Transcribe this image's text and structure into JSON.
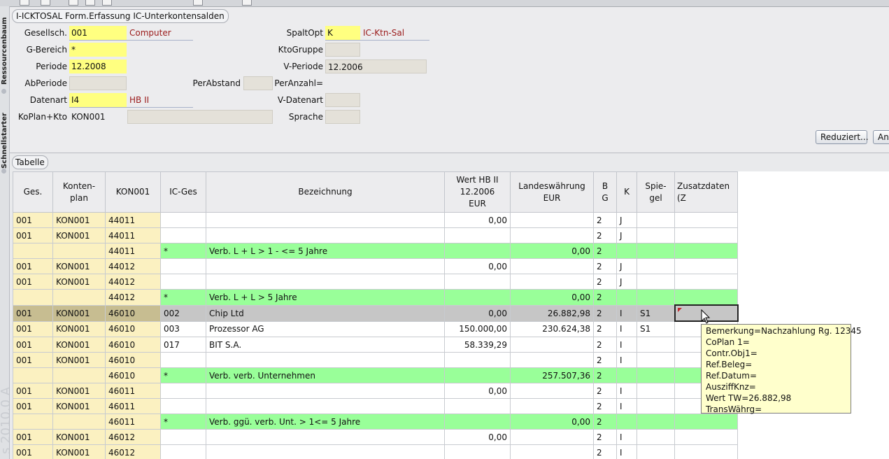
{
  "panel": {
    "title": "I-ICKTOSAL Form.Erfassung IC-Unterkontensalden"
  },
  "sidebar": {
    "tab1": "Ressourcenbaum",
    "tab2": "Schnellstarter",
    "watermark": "s 2010.0 A"
  },
  "form": {
    "gesellsch": {
      "label": "Gesellsch.",
      "value": "001",
      "desc": "Computer"
    },
    "gbereich": {
      "label": "G-Bereich",
      "value": "*"
    },
    "periode": {
      "label": "Periode",
      "value": "12.2008"
    },
    "abperiode": {
      "label": "AbPeriode",
      "value": ""
    },
    "perabstand": {
      "label": "PerAbstand",
      "value": ""
    },
    "datenart": {
      "label": "Datenart",
      "value": "I4",
      "desc": "HB II"
    },
    "koplan": {
      "label": "KoPlan+Kto",
      "value": "KON001",
      "value2": ""
    },
    "spaltopt": {
      "label": "SpaltOpt",
      "value": "K",
      "desc": "IC-Ktn-Sal"
    },
    "ktogruppe": {
      "label": "KtoGruppe",
      "value": ""
    },
    "vperiode": {
      "label": "V-Periode",
      "value": "12.2006"
    },
    "peranzahl": {
      "label": "PerAnzahl="
    },
    "vdatenart": {
      "label": "V-Datenart",
      "value": ""
    },
    "sprache": {
      "label": "Sprache",
      "value": ""
    }
  },
  "buttons": {
    "reduziert": "Reduziert...",
    "an": "An"
  },
  "table": {
    "tab_label": "Tabelle",
    "headers": [
      "Ges.",
      "Konten-\nplan",
      "KON001",
      "IC-Ges",
      "Bezeichnung",
      "Wert HB II\n12.2006\nEUR",
      "Landeswährung\nEUR",
      "B\nG",
      "K",
      "Spie-\ngel",
      "Zusatzdaten (Z"
    ],
    "rows": [
      {
        "type": "normal",
        "cells": [
          "001",
          "KON001",
          "44011",
          "",
          "",
          "0,00",
          "",
          "2",
          "J",
          "",
          ""
        ]
      },
      {
        "type": "normal",
        "cells": [
          "001",
          "KON001",
          "44011",
          "",
          "",
          "",
          "",
          "2",
          "J",
          "",
          ""
        ]
      },
      {
        "type": "green",
        "cells": [
          "",
          "",
          "44011",
          "*",
          "Verb. L + L   > 1 - <= 5 Jahre",
          "",
          "0,00",
          "2",
          "",
          "",
          ""
        ]
      },
      {
        "type": "normal",
        "cells": [
          "001",
          "KON001",
          "44012",
          "",
          "",
          "0,00",
          "",
          "2",
          "J",
          "",
          ""
        ]
      },
      {
        "type": "normal",
        "cells": [
          "001",
          "KON001",
          "44012",
          "",
          "",
          "",
          "",
          "2",
          "J",
          "",
          ""
        ]
      },
      {
        "type": "green",
        "cells": [
          "",
          "",
          "44012",
          "*",
          "Verb. L + L   > 5 Jahre",
          "",
          "0,00",
          "2",
          "",
          "",
          ""
        ]
      },
      {
        "type": "selected",
        "cells": [
          "001",
          "KON001",
          "46010",
          "002",
          "Chip Ltd",
          "0,00",
          "26.882,98",
          "2",
          "I",
          "S1",
          ""
        ]
      },
      {
        "type": "normal",
        "cells": [
          "001",
          "KON001",
          "46010",
          "003",
          "Prozessor AG",
          "150.000,00",
          "230.624,38",
          "2",
          "I",
          "S1",
          ""
        ]
      },
      {
        "type": "normal",
        "cells": [
          "001",
          "KON001",
          "46010",
          "017",
          "BIT S.A.",
          "58.339,29",
          "",
          "2",
          "I",
          "",
          ""
        ]
      },
      {
        "type": "normal",
        "cells": [
          "001",
          "KON001",
          "46010",
          "",
          "",
          "",
          "",
          "2",
          "I",
          "",
          ""
        ]
      },
      {
        "type": "green",
        "cells": [
          "",
          "",
          "46010",
          "*",
          "Verb. verb. Unternehmen",
          "",
          "257.507,36",
          "2",
          "",
          "",
          ""
        ]
      },
      {
        "type": "normal",
        "cells": [
          "001",
          "KON001",
          "46011",
          "",
          "",
          "0,00",
          "",
          "2",
          "I",
          "",
          ""
        ]
      },
      {
        "type": "normal",
        "cells": [
          "001",
          "KON001",
          "46011",
          "",
          "",
          "",
          "",
          "2",
          "I",
          "",
          ""
        ]
      },
      {
        "type": "green",
        "cells": [
          "",
          "",
          "46011",
          "*",
          "Verb. ggü. verb. Unt. > 1<= 5 Jahre",
          "",
          "0,00",
          "2",
          "",
          "",
          ""
        ]
      },
      {
        "type": "normal",
        "cells": [
          "001",
          "KON001",
          "46012",
          "",
          "",
          "0,00",
          "",
          "2",
          "I",
          "",
          ""
        ]
      },
      {
        "type": "normal",
        "cells": [
          "001",
          "KON001",
          "46012",
          "",
          "",
          "",
          "",
          "2",
          "I",
          "",
          ""
        ]
      }
    ]
  },
  "tooltip": {
    "lines": [
      "Bemerkung=Nachzahlung Rg. 12345",
      "CoPlan 1=",
      "Contr.Obj1=",
      "Ref.Beleg=",
      "Ref.Datum=",
      "AusziffKnz=",
      "Wert TW=26.882,98",
      "TransWährg="
    ]
  },
  "colors": {
    "required_field": "#ffff80",
    "group_row": "#99ff99",
    "key_column": "#fbf1c1",
    "selected_row": "#c6c6c6",
    "tooltip_bg": "#ffffcc"
  }
}
